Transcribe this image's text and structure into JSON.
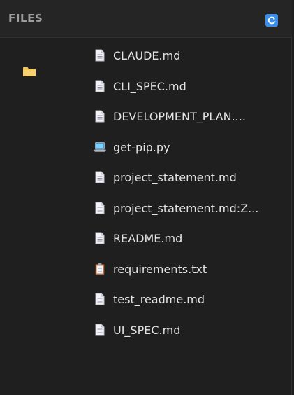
{
  "header": {
    "title": "FILES",
    "refresh_icon": "refresh-icon"
  },
  "folder": {
    "icon": "folder-icon",
    "color": "#f2c55c"
  },
  "files": [
    {
      "name": "CLAUDE.md",
      "icon": "document-icon"
    },
    {
      "name": "CLI_SPEC.md",
      "icon": "document-icon"
    },
    {
      "name": "DEVELOPMENT_PLAN....",
      "icon": "document-icon"
    },
    {
      "name": "get-pip.py",
      "icon": "laptop-icon"
    },
    {
      "name": "project_statement.md",
      "icon": "document-icon"
    },
    {
      "name": "project_statement.md:Z...",
      "icon": "document-icon"
    },
    {
      "name": "README.md",
      "icon": "document-icon"
    },
    {
      "name": "requirements.txt",
      "icon": "clipboard-icon"
    },
    {
      "name": "test_readme.md",
      "icon": "document-icon"
    },
    {
      "name": "UI_SPEC.md",
      "icon": "document-icon"
    }
  ],
  "colors": {
    "background": "#1f1f1f",
    "header": "#252526",
    "text": "#e4e4e4",
    "accent": "#3b8ee8"
  }
}
